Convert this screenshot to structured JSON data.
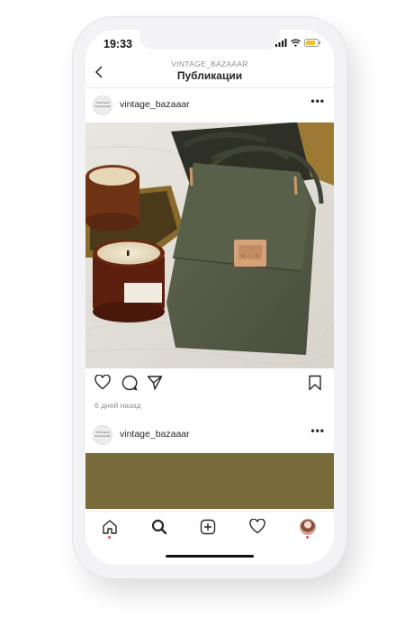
{
  "status_bar": {
    "time": "19:33"
  },
  "navbar": {
    "back_icon": "chevron-left-icon",
    "subtitle": "VINTAGE_BAZAAAR",
    "title": "Публикации"
  },
  "posts": [
    {
      "username": "vintage_bazaaar",
      "avatar_text": "VINTAGE BAZAAAR",
      "more_label": "•••",
      "image": "olive green leather crossbody bag with gold clasp beside scented candles on a textured rug",
      "time_ago": "6 дней назад"
    },
    {
      "username": "vintage_bazaaar",
      "avatar_text": "VINTAGE BAZAAAR",
      "more_label": "•••",
      "image_color": "#7a6c3a"
    }
  ],
  "action_icons": [
    "heart-icon",
    "comment-icon",
    "share-icon",
    "bookmark-icon"
  ],
  "tab_bar": [
    "home-icon",
    "search-icon",
    "new-post-icon",
    "activity-icon",
    "profile-avatar"
  ],
  "colors": {
    "notification_dot": "#ed4956",
    "secondary_text": "#8e8e8e"
  }
}
